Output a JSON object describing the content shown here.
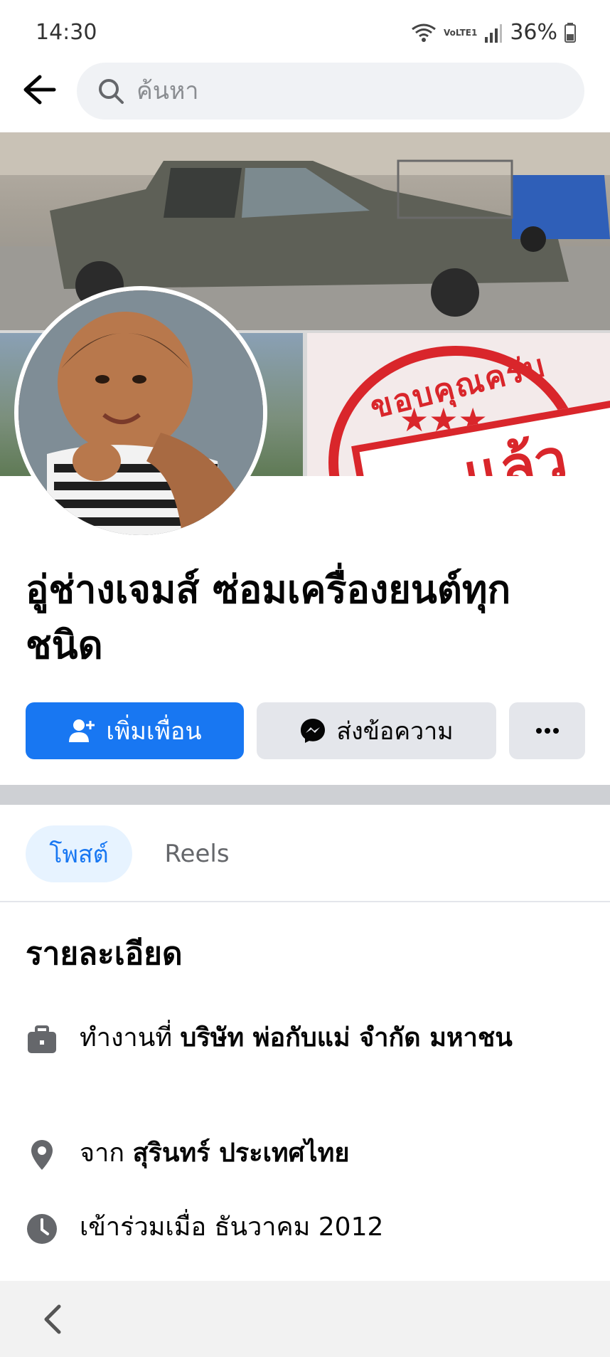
{
  "status_bar": {
    "time": "14:30",
    "network": "VoLTE1",
    "battery": "36%"
  },
  "search": {
    "placeholder": "ค้นหา"
  },
  "cover": {
    "stamp_text": "ขอบคุณครับ",
    "stamp_band_text": "แล้ว"
  },
  "profile": {
    "name": "อู่ช่างเจมส์ ซ่อมเครื่องยนต์ทุกชนิด"
  },
  "actions": {
    "add_friend": "เพิ่มเพื่อน",
    "message": "ส่งข้อความ",
    "more": "⋯"
  },
  "tabs": [
    {
      "label": "โพสต์",
      "active": true
    },
    {
      "label": "Reels",
      "active": false
    }
  ],
  "details": {
    "heading": "รายละเอียด",
    "work_prefix": "ทำงานที่",
    "work_place": "บริษัท พ่อกับแม่ จำกัด มหาชน",
    "from_prefix": "จาก",
    "from_place": "สุรินทร์ ประเทศไทย",
    "joined": "เข้าร่วมเมื่อ ธันวาคม  2012"
  },
  "colors": {
    "primary": "#1877f2",
    "secondary_button": "#e4e6eb",
    "active_tab_bg": "#e7f3ff",
    "stamp_red": "#d9262b"
  },
  "icons": [
    "back-arrow-icon",
    "search-icon",
    "wifi-icon",
    "signal-icon",
    "battery-icon",
    "add-friend-icon",
    "messenger-icon",
    "more-icon",
    "briefcase-icon",
    "location-pin-icon",
    "clock-icon",
    "nav-back-icon"
  ]
}
